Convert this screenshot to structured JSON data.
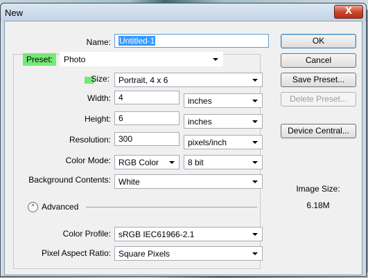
{
  "window": {
    "title": "New",
    "close_label": "X"
  },
  "form": {
    "name_label": "Name:",
    "name_value": "Untitled-1",
    "preset_label": "Preset:",
    "preset_value": "Photo",
    "size_label": "Size:",
    "size_value": "Portrait, 4 x 6",
    "width_label": "Width:",
    "width_value": "4",
    "width_unit": "inches",
    "height_label": "Height:",
    "height_value": "6",
    "height_unit": "inches",
    "resolution_label": "Resolution:",
    "resolution_value": "300",
    "resolution_unit": "pixels/inch",
    "color_mode_label": "Color Mode:",
    "color_mode_value": "RGB Color",
    "bit_depth_value": "8 bit",
    "background_label": "Background Contents:",
    "background_value": "White",
    "advanced_label": "Advanced",
    "advanced_icon": "double-chevron-up-icon",
    "color_profile_label": "Color Profile:",
    "color_profile_value": "sRGB IEC61966-2.1",
    "pixel_aspect_label": "Pixel Aspect Ratio:",
    "pixel_aspect_value": "Square Pixels"
  },
  "buttons": {
    "ok": "OK",
    "cancel": "Cancel",
    "save_preset": "Save Preset...",
    "delete_preset": "Delete Preset...",
    "device_central": "Device Central..."
  },
  "image_size": {
    "label": "Image Size:",
    "value": "6.18M"
  },
  "colors": {
    "highlight": "#76e876",
    "selection": "#3399ff"
  }
}
